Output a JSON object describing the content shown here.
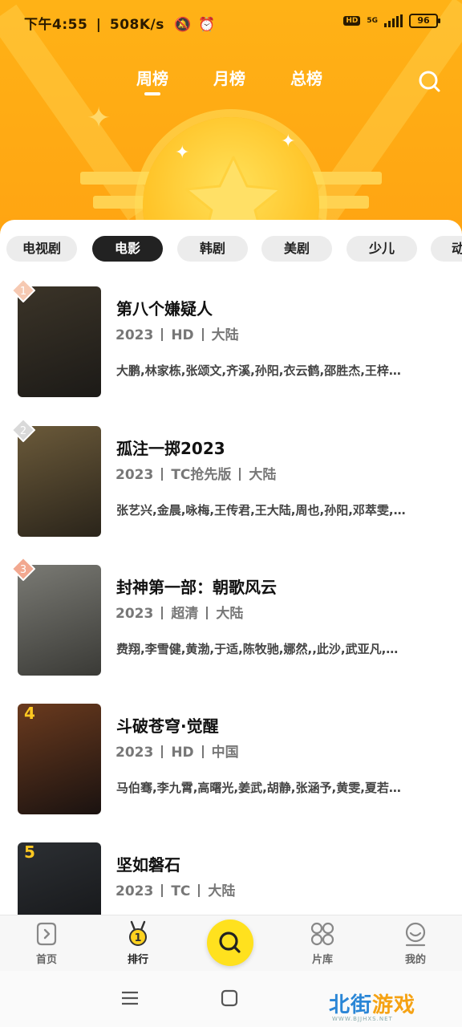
{
  "status_bar": {
    "time": "下午4:55",
    "speed": "508K/s",
    "hd": "HD",
    "network": "5G",
    "battery": "96"
  },
  "top_tabs": [
    {
      "label": "周榜",
      "active": true
    },
    {
      "label": "月榜",
      "active": false
    },
    {
      "label": "总榜",
      "active": false
    }
  ],
  "categories": [
    {
      "label": "电视剧",
      "active": false
    },
    {
      "label": "电影",
      "active": true
    },
    {
      "label": "韩剧",
      "active": false
    },
    {
      "label": "美剧",
      "active": false
    },
    {
      "label": "少儿",
      "active": false
    },
    {
      "label": "动",
      "active": false
    }
  ],
  "items": [
    {
      "rank": "1",
      "title": "第八个嫌疑人",
      "meta": [
        "2023",
        "HD",
        "大陆"
      ],
      "cast": "大鹏,林家栋,张颂文,齐溪,孙阳,衣云鹤,邵胜杰,王梓…",
      "poster_colors": [
        "#3b3428",
        "#1c1a17"
      ]
    },
    {
      "rank": "2",
      "title": "孤注一掷2023",
      "meta": [
        "2023",
        "TC抢先版",
        "大陆"
      ],
      "cast": "张艺兴,金晨,咏梅,王传君,王大陆,周也,孙阳,邓萃雯,…",
      "poster_colors": [
        "#6b5a3a",
        "#2a241a"
      ]
    },
    {
      "rank": "3",
      "title": "封神第一部：朝歌风云",
      "meta": [
        "2023",
        "超清",
        "大陆"
      ],
      "cast": "费翔,李雪健,黄渤,于适,陈牧驰,娜然,,此沙,武亚凡,…",
      "poster_colors": [
        "#7a7a74",
        "#3a3a36"
      ]
    },
    {
      "rank": "4",
      "title": "斗破苍穹·觉醒",
      "meta": [
        "2023",
        "HD",
        "中国"
      ],
      "cast": "马伯骞,李九霄,高曙光,姜武,胡静,张涵予,黄雯,夏若…",
      "poster_colors": [
        "#6a3a1e",
        "#1a1210"
      ]
    },
    {
      "rank": "5",
      "title": "坚如磐石",
      "meta": [
        "2023",
        "TC",
        "大陆"
      ],
      "cast": "",
      "poster_colors": [
        "#2c2f33",
        "#111214"
      ]
    }
  ],
  "bottom_nav": [
    {
      "label": "首页",
      "icon": "home-icon",
      "active": false
    },
    {
      "label": "排行",
      "icon": "medal-icon",
      "active": true,
      "badge": "1"
    },
    {
      "label": "",
      "icon": "search-icon",
      "active": false
    },
    {
      "label": "片库",
      "icon": "grid-icon",
      "active": false
    },
    {
      "label": "我的",
      "icon": "profile-icon",
      "active": false
    }
  ],
  "watermark": {
    "main_a": "北街",
    "main_b": "游戏",
    "sub": "WWW.BJJHXS.NET"
  },
  "colors": {
    "accent": "#ffb216",
    "fab": "#ffe11e",
    "rank_top3": "#f6c9b2",
    "rank_gold": "#ffc821"
  }
}
